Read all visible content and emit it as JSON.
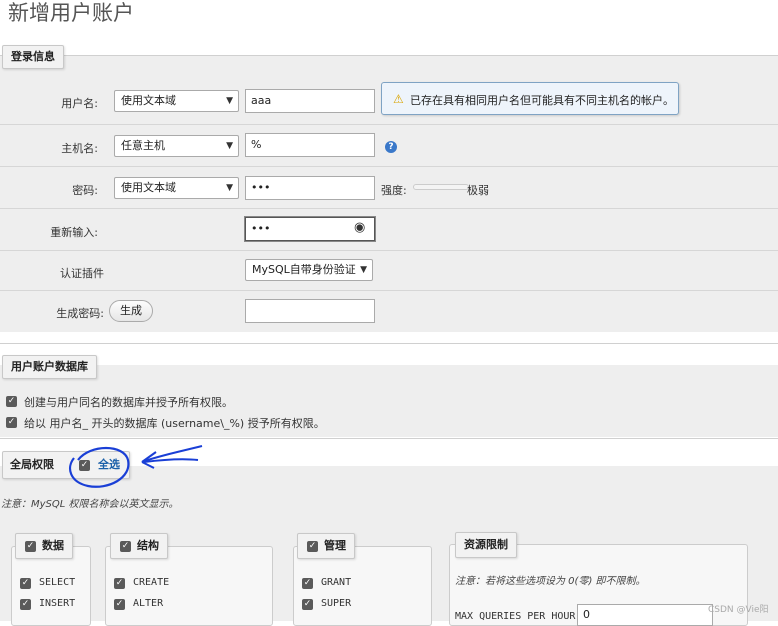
{
  "page": {
    "title": "新增用户账户"
  },
  "login": {
    "legend": "登录信息",
    "username": {
      "label": "用户名:",
      "select": "使用文本域",
      "value": "aaa",
      "warning": "已存在具有相同用户名但可能具有不同主机名的帐户。"
    },
    "host": {
      "label": "主机名:",
      "select": "任意主机",
      "value": "%"
    },
    "password": {
      "label": "密码:",
      "select": "使用文本域",
      "value": "•••",
      "strength_label": "强度:",
      "strength_value": "极弱"
    },
    "reenter": {
      "label": "重新输入:",
      "value": "•••"
    },
    "auth_plugin": {
      "label": "认证插件",
      "select": "MySQL自带身份验证"
    },
    "generate": {
      "label": "生成密码:",
      "button": "生成"
    }
  },
  "db": {
    "legend": "用户账户数据库",
    "options": [
      "创建与用户同名的数据库并授予所有权限。",
      "给以 用户名_ 开头的数据库 (username\\_%) 授予所有权限。"
    ]
  },
  "global": {
    "legend": "全局权限",
    "select_all": "全选",
    "note": "注意：MySQL 权限名称会以英文显示。",
    "groups": {
      "data": {
        "legend": "数据",
        "items": [
          "SELECT",
          "INSERT"
        ]
      },
      "structure": {
        "legend": "结构",
        "items": [
          "CREATE",
          "ALTER"
        ]
      },
      "admin": {
        "legend": "管理",
        "items": [
          "GRANT",
          "SUPER"
        ]
      },
      "resource": {
        "legend": "资源限制",
        "note": "注意：若将这些选项设为 0(零) 即不限制。",
        "max_queries_label": "MAX QUERIES PER HOUR",
        "max_queries_value": "0"
      }
    }
  },
  "watermark": "CSDN @Vie阳",
  "colors": {
    "warning_border": "#7fa3c4",
    "warning_bg": "#eef4fb",
    "annotation_ink": "#1a3fd6"
  }
}
